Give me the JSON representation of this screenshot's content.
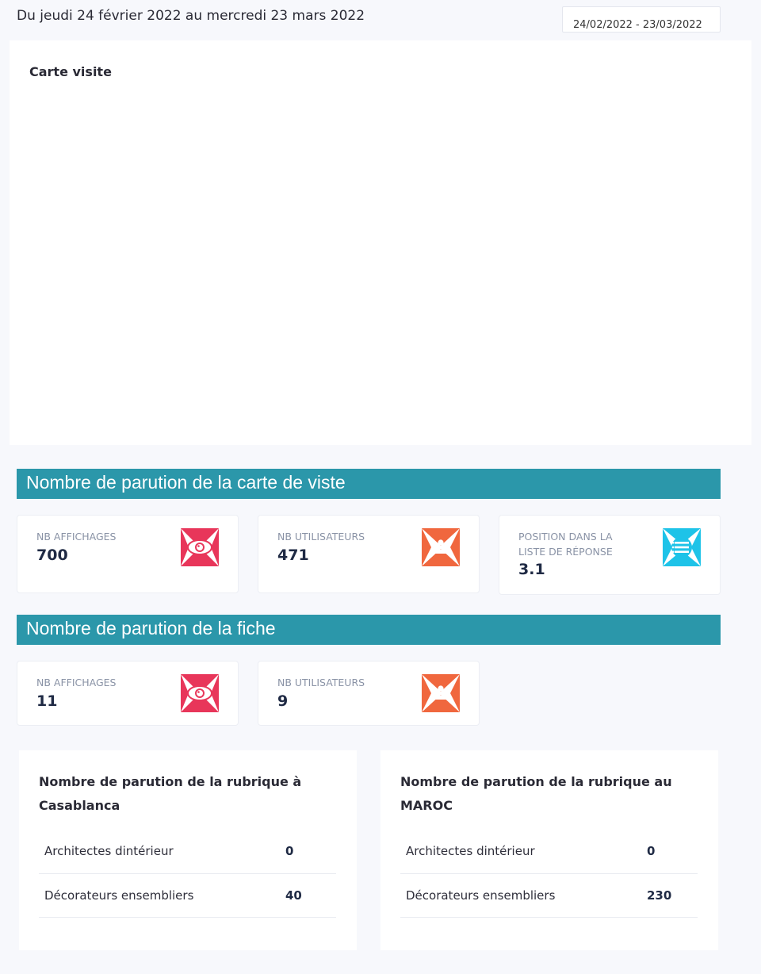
{
  "header": {
    "period": "Du jeudi 24 février 2022 au mercredi 23 mars 2022",
    "date_range_value": "24/02/2022 - 23/03/2022"
  },
  "map_card": {
    "title": "Carte visite"
  },
  "section_carte": {
    "title": "Nombre de parution de la carte de viste",
    "stats": [
      {
        "label": "NB AFFICHAGES",
        "value": "700",
        "icon": "eye-icon",
        "color": "#e8365a"
      },
      {
        "label": "NB UTILISATEURS",
        "value": "471",
        "icon": "users-icon",
        "color": "#f0673e"
      },
      {
        "label": "POSITION DANS LA LISTE DE RÉPONSE",
        "value": "3.1",
        "icon": "list-icon",
        "color": "#1ec3e8"
      }
    ]
  },
  "section_fiche": {
    "title": "Nombre de parution de la fiche",
    "stats": [
      {
        "label": "NB AFFICHAGES",
        "value": "11",
        "icon": "eye-icon",
        "color": "#e8365a"
      },
      {
        "label": "NB UTILISATEURS",
        "value": "9",
        "icon": "users-icon",
        "color": "#f0673e"
      }
    ]
  },
  "rubrique_casablanca": {
    "title": "Nombre de parution de la rubrique à Casablanca",
    "rows": [
      {
        "name": "Architectes dintérieur",
        "count": "0"
      },
      {
        "name": "Décorateurs ensembliers",
        "count": "40"
      }
    ]
  },
  "rubrique_maroc": {
    "title": "Nombre de parution de la rubrique au MAROC",
    "rows": [
      {
        "name": "Architectes dintérieur",
        "count": "0"
      },
      {
        "name": "Décorateurs ensembliers",
        "count": "230"
      }
    ]
  }
}
